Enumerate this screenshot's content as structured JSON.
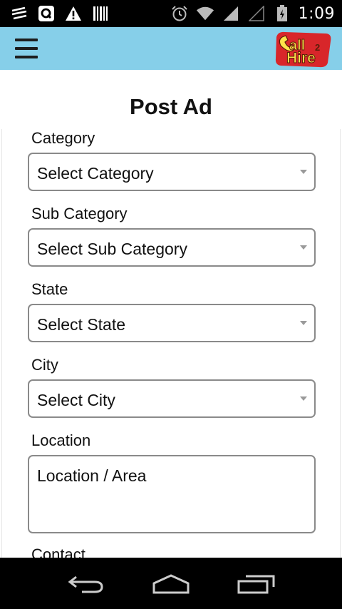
{
  "status_bar": {
    "time": "1:09",
    "left_icons": [
      "notification-icon",
      "q-app-icon",
      "warning-icon",
      "barcode-icon"
    ],
    "right_icons": [
      "alarm-icon",
      "wifi-icon",
      "signal-icon",
      "no-signal-icon",
      "battery-icon"
    ]
  },
  "header": {
    "menu_icon": "hamburger-menu-icon",
    "logo": {
      "line1": "all",
      "superscript": "2",
      "line2": "Hire",
      "colors": {
        "background": "#d8262a",
        "text_fill": "#ffe24a"
      }
    },
    "background": "#86cfe9"
  },
  "page": {
    "title": "Post Ad"
  },
  "form": {
    "fields": [
      {
        "label": "Category",
        "type": "select",
        "value": "Select Category"
      },
      {
        "label": "Sub Category",
        "type": "select",
        "value": "Select Sub Category"
      },
      {
        "label": "State",
        "type": "select",
        "value": "Select State"
      },
      {
        "label": "City",
        "type": "select",
        "value": "Select City"
      },
      {
        "label": "Location",
        "type": "textarea",
        "placeholder": "Location / Area"
      },
      {
        "label": "Contact",
        "type": "text"
      }
    ]
  },
  "nav_bar": {
    "icons": [
      "back-icon",
      "home-icon",
      "recent-apps-icon"
    ]
  }
}
